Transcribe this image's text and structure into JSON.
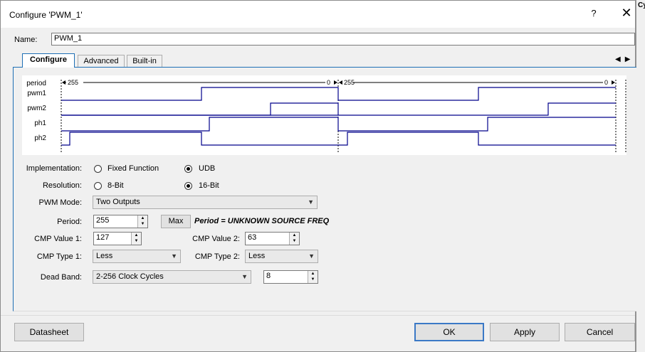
{
  "window": {
    "title": "Configure 'PWM_1'",
    "help_glyph": "?",
    "close_glyph": "✕"
  },
  "background_text": "Cypre",
  "name": {
    "label": "Name:",
    "value": "PWM_1"
  },
  "tabs": [
    {
      "label": "Configure"
    },
    {
      "label": "Advanced"
    },
    {
      "label": "Built-in"
    }
  ],
  "tab_scroll": {
    "left": "◀",
    "right": "▶"
  },
  "waveform": {
    "signals": [
      "period",
      "pwm1",
      "pwm2",
      "ph1",
      "ph2"
    ],
    "period_labels": {
      "start1": "255",
      "end1": "0",
      "start2": "255",
      "end2": "0"
    }
  },
  "implementation": {
    "label": "Implementation:",
    "options": [
      "Fixed Function",
      "UDB"
    ],
    "selected": "UDB"
  },
  "resolution": {
    "label": "Resolution:",
    "options": [
      "8-Bit",
      "16-Bit"
    ],
    "selected": "16-Bit"
  },
  "pwm_mode": {
    "label": "PWM Mode:",
    "value": "Two Outputs"
  },
  "period": {
    "label": "Period:",
    "value": "255",
    "max_button": "Max",
    "info": "Period = UNKNOWN SOURCE FREQ"
  },
  "cmp_value_1": {
    "label": "CMP Value 1:",
    "value": "127"
  },
  "cmp_value_2": {
    "label": "CMP Value 2:",
    "value": "63"
  },
  "cmp_type_1": {
    "label": "CMP Type 1:",
    "value": "Less"
  },
  "cmp_type_2": {
    "label": "CMP Type 2:",
    "value": "Less"
  },
  "dead_band": {
    "label": "Dead Band:",
    "value": "2-256 Clock Cycles",
    "cycles": "8"
  },
  "buttons": {
    "datasheet": "Datasheet",
    "ok": "OK",
    "apply": "Apply",
    "cancel": "Cancel"
  },
  "colors": {
    "trace": "#00008b",
    "accent": "#1e6fb5"
  },
  "icons": {
    "spin_up": "▲",
    "spin_down": "▼",
    "dropdown": "▼"
  }
}
